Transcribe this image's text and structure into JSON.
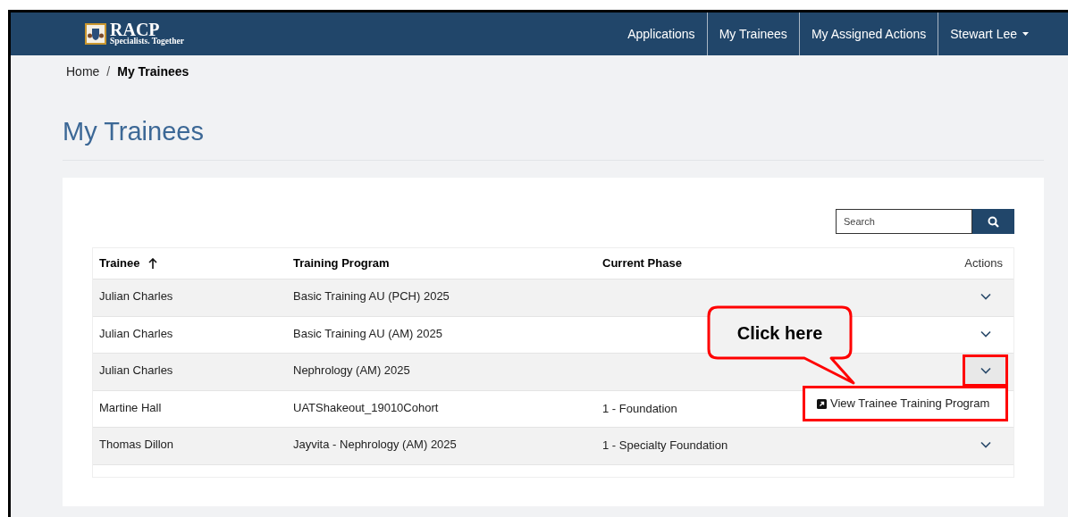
{
  "header": {
    "logo": {
      "name": "RACP",
      "tagline": "Specialists. Together"
    },
    "nav": [
      {
        "label": "Applications",
        "dropdown": false
      },
      {
        "label": "My Trainees",
        "dropdown": false
      },
      {
        "label": "My Assigned Actions",
        "dropdown": false
      },
      {
        "label": "Stewart Lee",
        "dropdown": true
      }
    ]
  },
  "breadcrumb": [
    {
      "label": "Home",
      "current": false
    },
    {
      "label": "My Trainees",
      "current": true,
      "separator": "/"
    }
  ],
  "title": "My Trainees",
  "search": {
    "placeholder": "Search"
  },
  "table": {
    "columns": [
      {
        "label": "Trainee",
        "sorted_ascending": true
      },
      {
        "label": "Training Program"
      },
      {
        "label": "Current Phase"
      },
      {
        "label": "Actions"
      }
    ],
    "rows": [
      {
        "trainee": "Julian Charles",
        "program": "Basic Training AU (PCH) 2025",
        "menu_open": false
      },
      {
        "trainee": "Julian Charles",
        "program": "Basic Training AU (AM) 2025",
        "menu_open": false
      },
      {
        "trainee": "Julian Charles",
        "program": "Nephrology (AM) 2025",
        "menu_open": true
      },
      {
        "trainee": "Martine Hall",
        "program": "UATShakeout_19010Cohort",
        "phase": "1 - Foundation",
        "menu_open": false
      },
      {
        "trainee": "Thomas Dillon",
        "program": "Jayvita - Nephrology (AM) 2025",
        "phase": "1 - Specialty Foundation",
        "menu_open": false
      }
    ]
  },
  "action_menu": {
    "items": [
      "View Trainee Training Program"
    ]
  },
  "callout": {
    "text": "Click here"
  }
}
